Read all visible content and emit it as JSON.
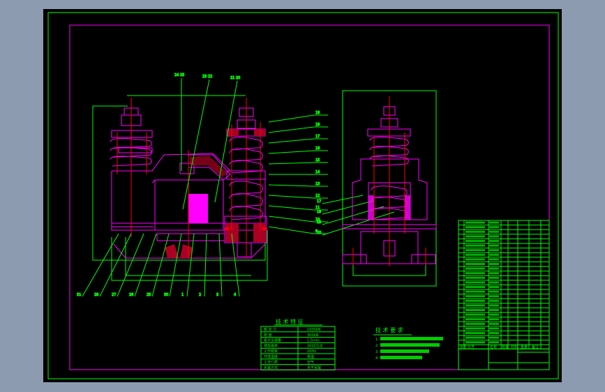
{
  "colors": {
    "background": "#8c9bb0",
    "canvas": "#000000",
    "frame": "#00ff00",
    "border": "#ff00ff",
    "part_lines": "#ff00ff",
    "centerlines": "#ff0000"
  },
  "tech_spec": {
    "title": "技 术 特 征",
    "rows": [
      [
        "额 定 力",
        "1000kN"
      ],
      [
        "刚    度",
        "300kN"
      ],
      [
        "最大压缩量",
        "1.5mm"
      ],
      [
        "使用寿命",
        "3000万次"
      ],
      [
        "工作频率",
        "20Hz"
      ],
      [
        "环境温度",
        "常温"
      ],
      [
        "工作介质",
        "空气"
      ],
      [
        "安装方式",
        "水平安装"
      ]
    ]
  },
  "tech_req": {
    "title": "技 术 要 求",
    "items": [
      "1.",
      "2.",
      "3.",
      "4."
    ]
  },
  "balloons": {
    "top": [
      "24",
      "25",
      "23",
      "22",
      "21",
      "20"
    ],
    "right": [
      "19",
      "18",
      "17",
      "16",
      "15",
      "14",
      "13",
      "12",
      "11",
      "10",
      "9",
      "8",
      "7",
      "6",
      "5"
    ],
    "bottom": [
      "31",
      "28",
      "27",
      "26",
      "25",
      "30",
      "1",
      "2",
      "3",
      "4"
    ],
    "side": [
      "17",
      "18",
      "19",
      "20"
    ]
  },
  "title_block": {
    "header": [
      "序号",
      "代号",
      "名称",
      "数量",
      "材料",
      "重量",
      "备注"
    ]
  }
}
